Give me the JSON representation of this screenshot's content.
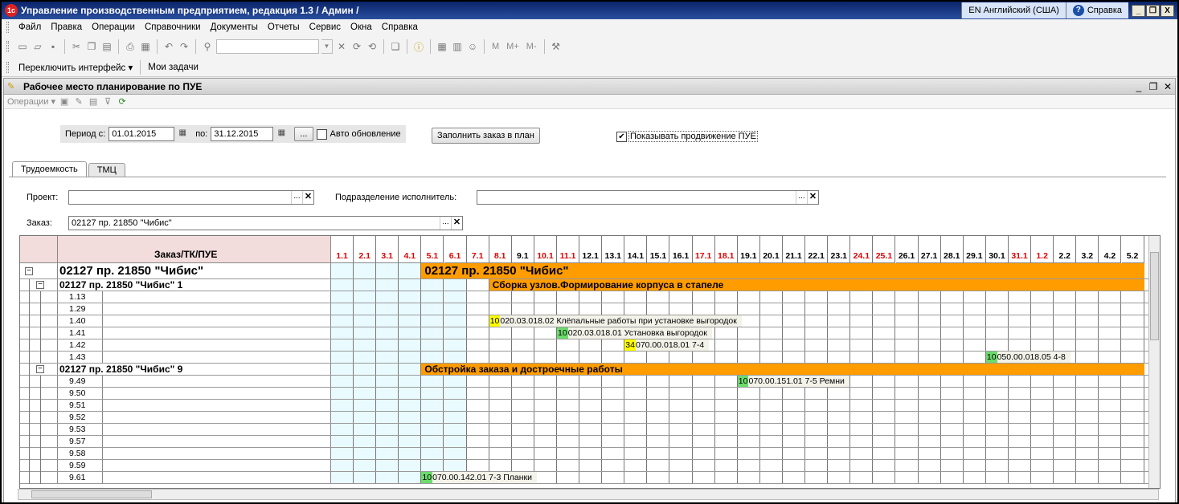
{
  "window": {
    "logo": "1с",
    "title": "Управление производственным предприятием, редакция 1.3 / Админ /",
    "language": "EN Английский (США)",
    "help": "Справка",
    "help_icon": "?",
    "minimize": "_",
    "restore": "❐",
    "close": "X"
  },
  "menu": [
    "Файл",
    "Правка",
    "Операции",
    "Справочники",
    "Документы",
    "Отчеты",
    "Сервис",
    "Окна",
    "Справка"
  ],
  "toolbar": {
    "icons": [
      "new-doc-icon",
      "open-folder-icon",
      "save-icon",
      "cut-icon",
      "copy-icon",
      "paste-icon",
      "print-icon",
      "preview-icon",
      "undo-icon",
      "redo-icon",
      "find-icon"
    ],
    "memory_buttons": [
      "M",
      "M+",
      "M-"
    ]
  },
  "toolbar2": {
    "switch_interface": "Переключить интерфейс ▾",
    "my_tasks": "Мои задачи"
  },
  "subwindow": {
    "title": "Рабочее место планирование по ПУЕ",
    "operations": "Операции ▾",
    "minimize": "_",
    "restore": "❐",
    "close": "✕"
  },
  "period": {
    "from_label": "Период с:",
    "from": "01.01.2015",
    "to_label": "по:",
    "to": "31.12.2015",
    "choose": "...",
    "auto_update": "Авто обновление",
    "auto_update_checked": false
  },
  "fill_button": "Заполнить заказ в план",
  "show_progress": {
    "label": "Показывать продвижение ПУЕ",
    "checked": true
  },
  "tabs": [
    "Трудоемкость",
    "ТМЦ"
  ],
  "filters": {
    "project_label": "Проект:",
    "project_value": "",
    "division_label": "Подразделение исполнитель:",
    "division_value": "",
    "order_label": "Заказ:",
    "order_value": "02127 пр. 21850  \"Чибис\"",
    "choose": "...",
    "clear": "✕"
  },
  "table": {
    "header": "Заказ/ТК/ПУЕ",
    "days": [
      {
        "label": "1.1",
        "red": true
      },
      {
        "label": "2.1",
        "red": true
      },
      {
        "label": "3.1",
        "red": true
      },
      {
        "label": "4.1",
        "red": true
      },
      {
        "label": "5.1",
        "red": true
      },
      {
        "label": "6.1",
        "red": true
      },
      {
        "label": "7.1",
        "red": true
      },
      {
        "label": "8.1",
        "red": true
      },
      {
        "label": "9.1",
        "red": false
      },
      {
        "label": "10.1",
        "red": true
      },
      {
        "label": "11.1",
        "red": true
      },
      {
        "label": "12.1",
        "red": false
      },
      {
        "label": "13.1",
        "red": false
      },
      {
        "label": "14.1",
        "red": false
      },
      {
        "label": "15.1",
        "red": false
      },
      {
        "label": "16.1",
        "red": false
      },
      {
        "label": "17.1",
        "red": true
      },
      {
        "label": "18.1",
        "red": true
      },
      {
        "label": "19.1",
        "red": false
      },
      {
        "label": "20.1",
        "red": false
      },
      {
        "label": "21.1",
        "red": false
      },
      {
        "label": "22.1",
        "red": false
      },
      {
        "label": "23.1",
        "red": false
      },
      {
        "label": "24.1",
        "red": true
      },
      {
        "label": "25.1",
        "red": true
      },
      {
        "label": "26.1",
        "red": false
      },
      {
        "label": "27.1",
        "red": false
      },
      {
        "label": "28.1",
        "red": false
      },
      {
        "label": "29.1",
        "red": false
      },
      {
        "label": "30.1",
        "red": false
      },
      {
        "label": "31.1",
        "red": true
      },
      {
        "label": "1.2",
        "red": true
      },
      {
        "label": "2.2",
        "red": false
      },
      {
        "label": "3.2",
        "red": false
      },
      {
        "label": "4.2",
        "red": false
      },
      {
        "label": "5.2",
        "red": false
      }
    ],
    "rows": [
      {
        "kind": "order",
        "expander": "−",
        "name": "02127 пр. 21850  \"Чибис\"",
        "bar": {
          "text": "02127 пр. 21850  \"Чибис\"",
          "start": 4
        }
      },
      {
        "kind": "tk",
        "expander": "−",
        "name": "02127 пр. 21850  \"Чибис\" 1",
        "bar": {
          "text": "Сборка узлов.Формирование корпуса в стапеле",
          "start": 7
        }
      },
      {
        "kind": "pue",
        "code": "1.13"
      },
      {
        "kind": "pue",
        "code": "1.29"
      },
      {
        "kind": "pue",
        "code": "1.40",
        "task": {
          "qty": "10",
          "color": "y",
          "text": "020.03.018.02 Клёпальные работы при установке выгородок",
          "start": 7
        }
      },
      {
        "kind": "pue",
        "code": "1.41",
        "task": {
          "qty": "10",
          "color": "g",
          "text": "020.03.018.01  Установка выгородок",
          "start": 10
        }
      },
      {
        "kind": "pue",
        "code": "1.42",
        "task": {
          "qty": "34",
          "color": "y",
          "text": "070.00.018.01  7-4",
          "start": 13
        }
      },
      {
        "kind": "pue",
        "code": "1.43",
        "task": {
          "qty": "10",
          "color": "g",
          "text": "050.00.018.05  4-8",
          "start": 29
        }
      },
      {
        "kind": "tk",
        "expander": "−",
        "name": "02127 пр. 21850  \"Чибис\" 9",
        "bar": {
          "text": "Обстройка заказа и достроечные работы",
          "start": 4
        }
      },
      {
        "kind": "pue",
        "code": "9.49",
        "task": {
          "qty": "10",
          "color": "g",
          "text": "070.00.151.01  7-5 Ремни",
          "start": 18
        }
      },
      {
        "kind": "pue",
        "code": "9.50"
      },
      {
        "kind": "pue",
        "code": "9.51"
      },
      {
        "kind": "pue",
        "code": "9.52"
      },
      {
        "kind": "pue",
        "code": "9.53"
      },
      {
        "kind": "pue",
        "code": "9.57"
      },
      {
        "kind": "pue",
        "code": "9.58"
      },
      {
        "kind": "pue",
        "code": "9.59"
      },
      {
        "kind": "pue",
        "code": "9.61",
        "task": {
          "qty": "10",
          "color": "g",
          "text": "070.00.142.01  7-3 Планки",
          "start": 4
        }
      }
    ]
  }
}
